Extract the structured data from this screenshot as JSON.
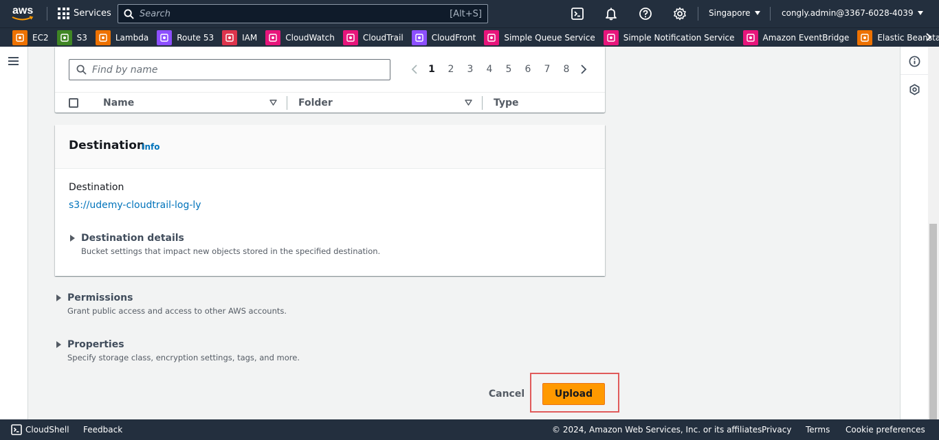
{
  "topnav": {
    "logo_text": "aws",
    "services_label": "Services",
    "search_placeholder": "Search",
    "search_shortcut": "[Alt+S]",
    "region": "Singapore",
    "account": "congly.admin@3367-6028-4039"
  },
  "favorites": [
    {
      "label": "EC2",
      "color": "#ed7100"
    },
    {
      "label": "S3",
      "color": "#3f8624"
    },
    {
      "label": "Lambda",
      "color": "#ed7100"
    },
    {
      "label": "Route 53",
      "color": "#8c4fff"
    },
    {
      "label": "IAM",
      "color": "#dd344c"
    },
    {
      "label": "CloudWatch",
      "color": "#e7157b"
    },
    {
      "label": "CloudTrail",
      "color": "#e7157b"
    },
    {
      "label": "CloudFront",
      "color": "#8c4fff"
    },
    {
      "label": "Simple Queue Service",
      "color": "#e7157b"
    },
    {
      "label": "Simple Notification Service",
      "color": "#e7157b"
    },
    {
      "label": "Amazon EventBridge",
      "color": "#e7157b"
    },
    {
      "label": "Elastic Beanstalk",
      "color": "#ed7100"
    }
  ],
  "files": {
    "find_placeholder": "Find by name",
    "pages": [
      "1",
      "2",
      "3",
      "4",
      "5",
      "6",
      "7",
      "8"
    ],
    "current_page": "1",
    "columns": {
      "name": "Name",
      "folder": "Folder",
      "type": "Type"
    }
  },
  "destination": {
    "title": "Destination",
    "info": "Info",
    "label": "Destination",
    "bucket_link": "s3://udemy-cloudtrail-log-ly",
    "details_title": "Destination details",
    "details_desc": "Bucket settings that impact new objects stored in the specified destination."
  },
  "permissions": {
    "title": "Permissions",
    "desc": "Grant public access and access to other AWS accounts."
  },
  "properties": {
    "title": "Properties",
    "desc": "Specify storage class, encryption settings, tags, and more."
  },
  "actions": {
    "cancel": "Cancel",
    "upload": "Upload"
  },
  "footer": {
    "cloudshell": "CloudShell",
    "feedback": "Feedback",
    "copyright": "© 2024, Amazon Web Services, Inc. or its affiliates.",
    "privacy": "Privacy",
    "terms": "Terms",
    "cookies": "Cookie preferences"
  },
  "colors": {
    "nav_bg": "#232f3e",
    "link": "#0073bb",
    "primary_button": "#ff9900",
    "highlight_border": "#e05a5a"
  }
}
